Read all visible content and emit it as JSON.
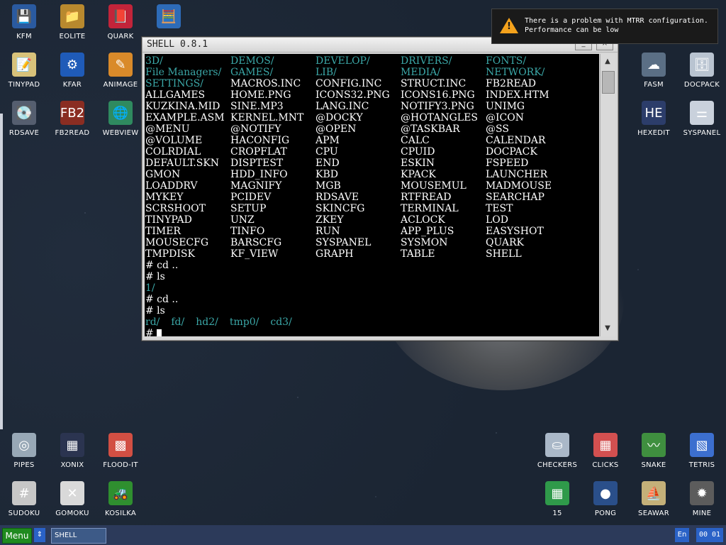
{
  "desktop": {
    "icons": [
      {
        "label": "KFM",
        "icon": "floppy-icon",
        "glyph": "💾",
        "bg": "#2a5aa0"
      },
      {
        "label": "EOLITE",
        "icon": "folder-icon",
        "glyph": "📁",
        "bg": "#b8892e"
      },
      {
        "label": "QUARK",
        "icon": "notebook-icon",
        "glyph": "📕",
        "bg": "#c2243a"
      },
      {
        "label": "",
        "icon": "calculator-icon",
        "glyph": "🧮",
        "bg": "#2d6bb7"
      },
      {
        "label": "TINYPAD",
        "icon": "notepad-icon",
        "glyph": "📝",
        "bg": "#d8c27a"
      },
      {
        "label": "KFAR",
        "icon": "kfar-icon",
        "glyph": "⚙",
        "bg": "#1f5bb8"
      },
      {
        "label": "ANIMAGE",
        "icon": "pencil-icon",
        "glyph": "✎",
        "bg": "#d98a2a"
      },
      {
        "label": "RDSAVE",
        "icon": "rdsave-icon",
        "glyph": "💽",
        "bg": "#555e6f"
      },
      {
        "label": "FB2READ",
        "icon": "book-icon",
        "glyph": "FB2",
        "bg": "#8a2d22"
      },
      {
        "label": "WEBVIEW",
        "icon": "globe-icon",
        "glyph": "🌐",
        "bg": "#2f8a5f"
      },
      {
        "label": "FASM",
        "icon": "fasm-icon",
        "glyph": "☁",
        "bg": "#5b6f85"
      },
      {
        "label": "DOCPACK",
        "icon": "docpack-icon",
        "glyph": "🗄",
        "bg": "#b9c4d1"
      },
      {
        "label": "HEXEDIT",
        "icon": "hexedit-icon",
        "glyph": "HE",
        "bg": "#2c3d6a"
      },
      {
        "label": "SYSPANEL",
        "icon": "syspanel-icon",
        "glyph": "⚌",
        "bg": "#c9d1dc"
      },
      {
        "label": "PIPES",
        "icon": "pipes-icon",
        "glyph": "◎",
        "bg": "#98a8b6"
      },
      {
        "label": "XONIX",
        "icon": "xonix-icon",
        "glyph": "▦",
        "bg": "#2b3450"
      },
      {
        "label": "FLOOD-IT",
        "icon": "flood-it-icon",
        "glyph": "▩",
        "bg": "#d24f43"
      },
      {
        "label": "SUDOKU",
        "icon": "sudoku-icon",
        "glyph": "#",
        "bg": "#c7c7c7"
      },
      {
        "label": "GOMOKU",
        "icon": "gomoku-icon",
        "glyph": "✕",
        "bg": "#d9d9d9"
      },
      {
        "label": "KOSILKA",
        "icon": "lawnmower-icon",
        "glyph": "🚜",
        "bg": "#2f8f2f"
      },
      {
        "label": "CHECKERS",
        "icon": "checkers-icon",
        "glyph": "⛀",
        "bg": "#aab8c8"
      },
      {
        "label": "CLICKS",
        "icon": "clicks-icon",
        "glyph": "▦",
        "bg": "#d35050"
      },
      {
        "label": "SNAKE",
        "icon": "snake-icon",
        "glyph": "〰",
        "bg": "#3f8f3f"
      },
      {
        "label": "TETRIS",
        "icon": "tetris-icon",
        "glyph": "▧",
        "bg": "#3c6fcf"
      },
      {
        "label": "15",
        "icon": "fifteen-icon",
        "glyph": "▦",
        "bg": "#2f9a4a"
      },
      {
        "label": "PONG",
        "icon": "pong-icon",
        "glyph": "●",
        "bg": "#2a4f8a"
      },
      {
        "label": "SEAWAR",
        "icon": "ship-icon",
        "glyph": "⛵",
        "bg": "#c4b079"
      },
      {
        "label": "MINE",
        "icon": "mine-icon",
        "glyph": "✹",
        "bg": "#5c5c5c"
      }
    ]
  },
  "shell_window": {
    "title": "SHELL 0.8.1",
    "minimize_label": "_",
    "close_label": "×",
    "scroll_up": "▲",
    "scroll_down": "▼",
    "listing": [
      [
        "3D/",
        "DEMOS/",
        "DEVELOP/",
        "DRIVERS/",
        "FONTS/"
      ],
      [
        "File Managers/",
        "GAMES/",
        "LIB/",
        "MEDIA/",
        "NETWORK/"
      ],
      [
        "SETTINGS/",
        "MACROS.INC",
        "CONFIG.INC",
        "STRUCT.INC",
        "FB2READ"
      ],
      [
        "ALLGAMES",
        "HOME.PNG",
        "ICONS32.PNG",
        "ICONS16.PNG",
        "INDEX.HTM"
      ],
      [
        "KUZKINA.MID",
        "SINE.MP3",
        "LANG.INC",
        "NOTIFY3.PNG",
        "UNIMG"
      ],
      [
        "EXAMPLE.ASM",
        "KERNEL.MNT",
        "@DOCKY",
        "@HOTANGLES",
        "@ICON"
      ],
      [
        "@MENU",
        "@NOTIFY",
        "@OPEN",
        "@TASKBAR",
        "@SS"
      ],
      [
        "@VOLUME",
        "HACONFIG",
        "APM",
        "CALC",
        "CALENDAR"
      ],
      [
        "COLRDIAL",
        "CROPFLAT",
        "CPU",
        "CPUID",
        "DOCPACK"
      ],
      [
        "DEFAULT.SKN",
        "DISPTEST",
        "END",
        "ESKIN",
        "FSPEED"
      ],
      [
        "GMON",
        "HDD_INFO",
        "KBD",
        "KPACK",
        "LAUNCHER"
      ],
      [
        "LOADDRV",
        "MAGNIFY",
        "MGB",
        "MOUSEMUL",
        "MADMOUSE"
      ],
      [
        "MYKEY",
        "PCIDEV",
        "RDSAVE",
        "RTFREAD",
        "SEARCHAP"
      ],
      [
        "SCRSHOOT",
        "SETUP",
        "SKINCFG",
        "TERMINAL",
        "TEST"
      ],
      [
        "TINYPAD",
        "UNZ",
        "ZKEY",
        "ACLOCK",
        "LOD"
      ],
      [
        "TIMER",
        "TINFO",
        "RUN",
        "APP_PLUS",
        "EASYSHOT"
      ],
      [
        "MOUSECFG",
        "BARSCFG",
        "SYSPANEL",
        "SYSMON",
        "QUARK"
      ],
      [
        "TMPDISK",
        "KF_VIEW",
        "GRAPH",
        "TABLE",
        "SHELL"
      ]
    ],
    "dir_rows": 2,
    "dir_extra": [
      [
        2,
        0
      ]
    ],
    "cmd1": "# cd ..",
    "cmd2": "# ls",
    "out1": "1/",
    "cmd3": "# cd ..",
    "cmd4": "# ls",
    "out2": [
      "rd/",
      "fd/",
      "hd2/",
      "tmp0/",
      "cd3/"
    ],
    "prompt": "#"
  },
  "notification": {
    "line1": "There is a problem with MTRR configuration.",
    "line2": "Performance can be low",
    "warn_glyph": "!"
  },
  "taskbar": {
    "menu_label": "Menu",
    "switch_glyph": "⇕",
    "task_label": "SHELL",
    "lang": "En",
    "clock": "00 01"
  },
  "colors": {
    "desktop_bg": "#1b2533",
    "terminal_bg": "#000000",
    "dir_color": "#3ba7a7",
    "file_color": "#ffffff",
    "menu_green": "#1f8a1f",
    "taskbar_bg": "#2c3a5a",
    "warning_orange": "#f4a21c"
  }
}
